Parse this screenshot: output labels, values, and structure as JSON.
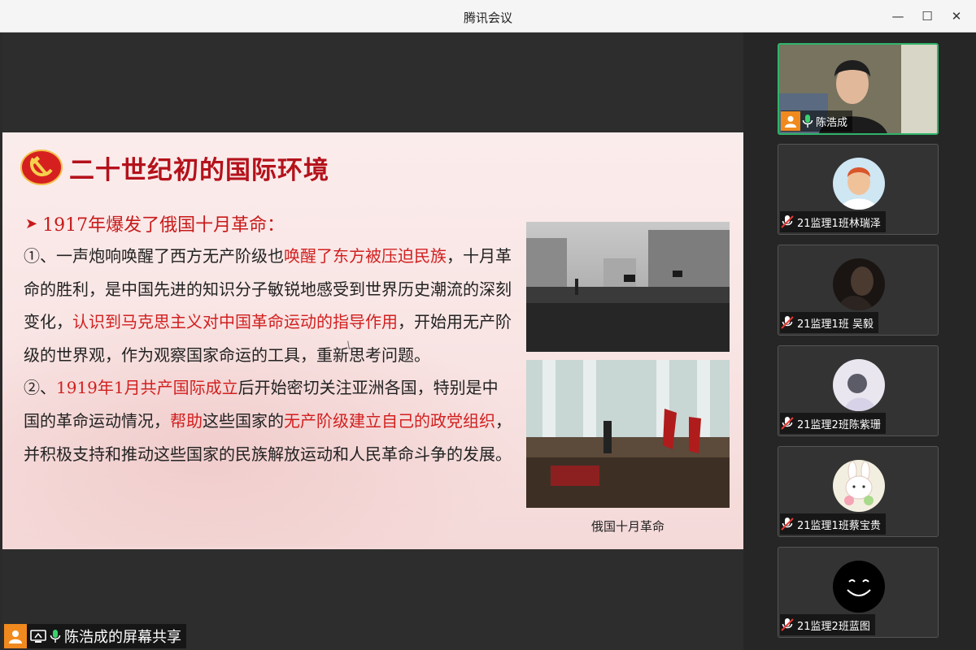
{
  "window": {
    "title": "腾讯会议",
    "minimize_glyph": "—",
    "maximize_glyph": "☐",
    "close_glyph": "✕"
  },
  "slide": {
    "heading": "二十世纪初的国际环境",
    "subheading": "1917年爆发了俄国十月革命：",
    "subheading_marker": "➤",
    "paragraph1": [
      {
        "t": "①、一声炮响唤醒了西方无产阶级也",
        "red": false
      },
      {
        "t": "唤醒了东方被压迫民族",
        "red": true
      },
      {
        "t": "，十月革命的胜利，是中国先进的知识分子敏锐地感受到世界历史潮流的深刻变化，",
        "red": false
      },
      {
        "t": "认识到马克思主义对中国革命运动的指导作用",
        "red": true
      },
      {
        "t": "，开始用无产阶级的世界观，作为观察国家命运的工具，重新思考问题。",
        "red": false
      }
    ],
    "paragraph2": [
      {
        "t": "②、",
        "red": false
      },
      {
        "t": "1919年1月共产国际成立",
        "red": true
      },
      {
        "t": "后开始密切关注亚洲各国，特别是中国的革命运动情况，",
        "red": false
      },
      {
        "t": "帮助",
        "red": true
      },
      {
        "t": "这些国家的",
        "red": false
      },
      {
        "t": "无产阶级建立自己的政党组织",
        "red": true
      },
      {
        "t": "，并积极支持和推动这些国家的民族解放运动和人民革命斗争的发展。",
        "red": false
      }
    ],
    "photo_caption": "俄国十月革命",
    "emblem_icon": "hammer-sickle-icon"
  },
  "share": {
    "label": "陈浩成的屏幕共享"
  },
  "participants": [
    {
      "name": "陈浩成",
      "mic": "on",
      "active": true
    },
    {
      "name": "21监理1班林瑞泽",
      "mic": "muted",
      "active": false
    },
    {
      "name": "21监理1班 吴毅",
      "mic": "muted",
      "active": false
    },
    {
      "name": "21监理2班陈紫珊",
      "mic": "muted",
      "active": false
    },
    {
      "name": "21监理1班蔡宝贵",
      "mic": "muted",
      "active": false
    },
    {
      "name": "21监理2班蓝图",
      "mic": "muted",
      "active": false
    }
  ],
  "colors": {
    "accent_red": "#c81a1a",
    "active_border": "#2fb46a",
    "avatar_orange": "#f08a1e"
  }
}
